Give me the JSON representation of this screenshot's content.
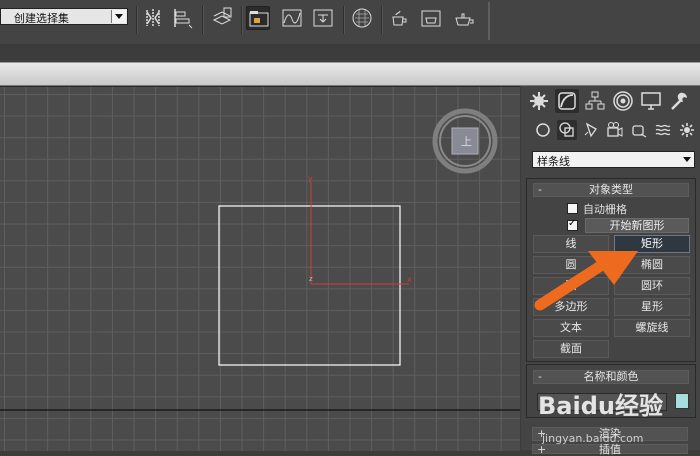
{
  "toolbar": {
    "selection_set": {
      "value": "创建选择集"
    },
    "icons": [
      "mirror-icon",
      "align-icon",
      "layer-manager-icon",
      "scene-explorer-icon",
      "curve-editor-icon",
      "schematic-view-icon",
      "material-editor-icon",
      "render-setup-icon",
      "rendered-frame-icon",
      "render-icon"
    ]
  },
  "command_panel": {
    "tabs": [
      "create-tab",
      "modify-tab",
      "hierarchy-tab",
      "motion-tab",
      "display-tab",
      "utilities-tab"
    ],
    "categories": [
      "geometry-icon",
      "shapes-icon",
      "lights-icon",
      "cameras-icon",
      "helpers-icon",
      "space-warps-icon",
      "systems-icon"
    ],
    "shape_type": {
      "value": "样条线"
    },
    "object_type": {
      "title": "对象类型",
      "collapse": "-",
      "auto_grid": "自动栅格",
      "start_new_shape": "开始新图形",
      "buttons": {
        "line": "线",
        "rectangle": "矩形",
        "circle": "圆",
        "ellipse": "椭圆",
        "arc": "弧",
        "donut": "圆环",
        "ngon": "多边形",
        "star": "星形",
        "text": "文本",
        "helix": "螺旋线",
        "section": "截面"
      }
    },
    "name_color": {
      "title": "名称和颜色",
      "collapse": "-",
      "color": "#a6dede"
    },
    "rendering": {
      "title": "渲染",
      "collapse": "+"
    },
    "interpolation": {
      "title": "插值",
      "collapse": "+"
    }
  },
  "viewport": {
    "axis_x": "x",
    "axis_y": "y",
    "axis_z": "z",
    "viewcube_label": "上"
  },
  "watermark": {
    "logo": "Baidu经验",
    "url": "jingyan.baidu.com"
  }
}
